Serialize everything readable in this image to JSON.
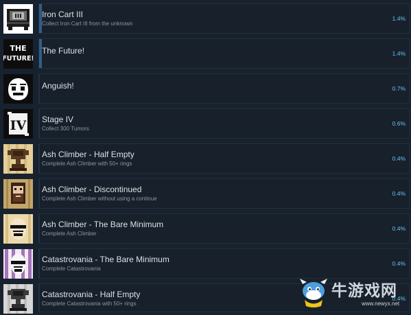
{
  "achievements": [
    {
      "title": "Iron Cart III",
      "description": "Collect Iron Cart III from the unknown",
      "percent": "1.4%",
      "icon": "iron-cart-icon",
      "progress": 0.014
    },
    {
      "title": "The Future!",
      "description": "",
      "percent": "1.4%",
      "icon": "the-future-icon",
      "icon_text": "THE FUTURE!",
      "progress": 0.014
    },
    {
      "title": "Anguish!",
      "description": "",
      "percent": "0.7%",
      "icon": "anguish-face-icon",
      "progress": 0.007
    },
    {
      "title": "Stage IV",
      "description": "Collect 300 Tumors",
      "percent": "0.6%",
      "icon": "stage-four-icon",
      "icon_text": "IV",
      "progress": 0.006
    },
    {
      "title": "Ash Climber - Half Empty",
      "description": "Complete Ash Climber with 50+ rings",
      "percent": "0.4%",
      "icon": "trophy-icon",
      "progress": 0.004
    },
    {
      "title": "Ash Climber - Discontinued",
      "description": "Complete Ash Climber without using a continue",
      "percent": "0.4%",
      "icon": "bearded-face-icon",
      "progress": 0.004
    },
    {
      "title": "Ash Climber - The Bare Minimum",
      "description": "Complete Ash Climber",
      "percent": "0.4%",
      "icon": "bandaged-face-icon",
      "progress": 0.004
    },
    {
      "title": "Catastrovania - The Bare Minimum",
      "description": "Complete Catastrovania",
      "percent": "0.4%",
      "icon": "bandaged-face-striped-icon",
      "progress": 0.004
    },
    {
      "title": "Catastrovania - Half Empty",
      "description": "Complete Catastrovania with 50+ rings",
      "percent": "0.4%",
      "icon": "gray-trophy-icon",
      "progress": 0.004
    }
  ],
  "watermark": {
    "text": "牛游戏网",
    "url": "www.newyx.net",
    "icon": "horned-mascot-logo"
  },
  "colors": {
    "background": "#18222e",
    "card": "#17202b",
    "percent": "#67c1f5",
    "title": "#dbe2e6",
    "description": "#8f98a0"
  }
}
